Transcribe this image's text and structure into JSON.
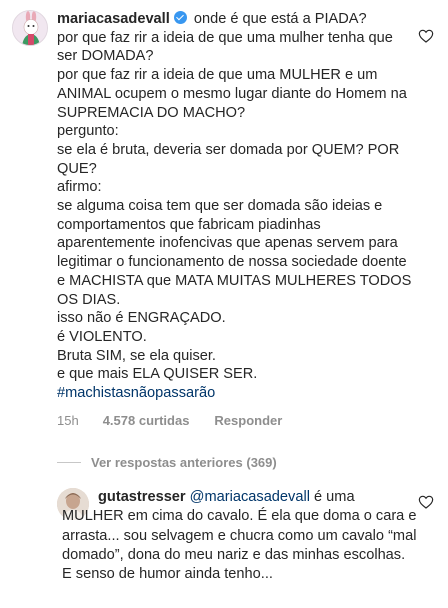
{
  "comment": {
    "username": "mariacasadevall",
    "avatar_icon": "avatar-illustration-icon",
    "verified_icon": "verified-badge-icon",
    "lines": [
      "onde é que está a PIADA?",
      "por que faz rir a ideia de que uma mulher tenha que ser DOMADA?",
      "por que faz rir a ideia de que uma MULHER e um ANIMAL ocupem o mesmo lugar diante do Homem na SUPREMACIA DO MACHO?",
      "pergunto:",
      "se ela é bruta, deveria ser domada por QUEM? POR QUE?",
      "afirmo:",
      "se alguma coisa tem que ser domada são ideias e comportamentos que fabricam piadinhas aparentemente inofencivas que apenas servem para legitimar o funcionamento de nossa sociedade doente e MACHISTA que MATA MUITAS MULHERES TODOS OS DIAS.",
      "isso não é ENGRAÇADO.",
      "é VIOLENTO.",
      "Bruta SIM, se ela quiser.",
      "e que mais ELA QUISER SER."
    ],
    "hashtag": "#machistasnãopassarão",
    "time": "15h",
    "likes": "4.578 curtidas",
    "reply_label": "Responder",
    "like_icon": "heart-outline-icon"
  },
  "replies_toggle": {
    "label": "Ver respostas anteriores (369)"
  },
  "reply": {
    "username": "gutastresser",
    "mention": "@mariacasadevall",
    "text": "é uma MULHER em cima do cavalo. É ela que doma o cara e arrasta... sou selvagem e chucra como um cavalo “mal domado”, dona do meu nariz e das minhas escolhas. E senso de humor ainda tenho...",
    "avatar_icon": "avatar-photo-icon",
    "like_icon": "heart-outline-icon"
  },
  "colors": {
    "text": "#262626",
    "muted": "#8e8e8e",
    "link": "#003569",
    "verified": "#3897f0"
  }
}
